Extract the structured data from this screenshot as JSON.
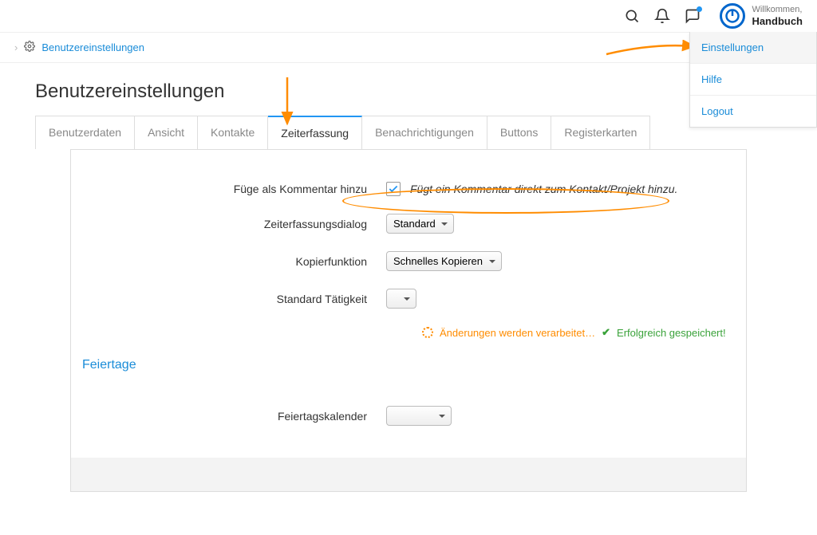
{
  "header": {
    "welcome_label": "Willkommen,",
    "user_name": "Handbuch"
  },
  "user_menu": {
    "items": [
      {
        "label": "Einstellungen",
        "active": true
      },
      {
        "label": "Hilfe",
        "active": false
      },
      {
        "label": "Logout",
        "active": false
      }
    ]
  },
  "breadcrumb": {
    "link": "Benutzereinstellungen"
  },
  "page_title": "Benutzereinstellungen",
  "tabs": [
    {
      "label": "Benutzerdaten",
      "active": false
    },
    {
      "label": "Ansicht",
      "active": false
    },
    {
      "label": "Kontakte",
      "active": false
    },
    {
      "label": "Zeiterfassung",
      "active": true
    },
    {
      "label": "Benachrichtigungen",
      "active": false
    },
    {
      "label": "Buttons",
      "active": false
    },
    {
      "label": "Registerkarten",
      "active": false
    }
  ],
  "form": {
    "add_as_comment_label": "Füge als Kommentar hinzu",
    "add_as_comment_checked": true,
    "add_as_comment_hint": "Fügt ein Kommentar direkt zum Kontakt/Projekt hinzu.",
    "dialog_label": "Zeiterfassungsdialog",
    "dialog_value": "Standard",
    "copy_label": "Kopierfunktion",
    "copy_value": "Schnelles Kopieren",
    "activity_label": "Standard Tätigkeit",
    "activity_value": "",
    "processing_text": "Änderungen werden verarbeitet…",
    "saved_text": "Erfolgreich gespeichert!",
    "holidays_heading": "Feiertage",
    "holiday_calendar_label": "Feiertagskalender",
    "holiday_calendar_value": ""
  }
}
